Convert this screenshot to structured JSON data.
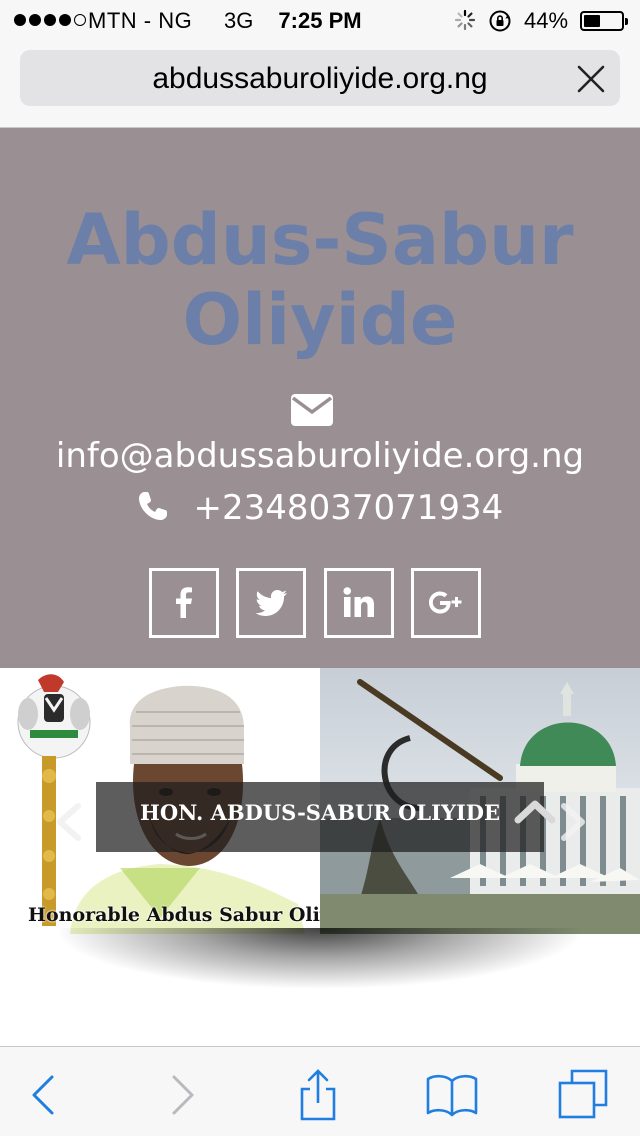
{
  "status_bar": {
    "carrier": "MTN - NG",
    "network": "3G",
    "time": "7:25 PM",
    "battery": "44%",
    "battery_level": 0.44
  },
  "browser": {
    "url": "abdussaburoliyide.org.ng",
    "load_progress": 0.26,
    "close_icon": "close-icon",
    "toolbar": [
      "back-icon",
      "forward-icon",
      "share-icon",
      "bookmarks-icon",
      "tabs-icon"
    ]
  },
  "hero": {
    "title_line1": "Abdus-Sabur",
    "title_line2": "Oliyide",
    "email": "info@abdussaburoliyide.org.ng",
    "phone": "+2348037071934",
    "social": [
      "facebook-icon",
      "twitter-icon",
      "linkedin-icon",
      "google-plus-icon"
    ]
  },
  "carousel": {
    "caption": "HON. ABDUS-SABUR OLIYIDE",
    "photo_label": "Honorable Abdus Sabur Oliyide"
  },
  "colors": {
    "hero_bg": "#9a8f93",
    "title": "#6b7fa8",
    "ios_blue": "#1f7ee0",
    "white": "#ffffff"
  }
}
